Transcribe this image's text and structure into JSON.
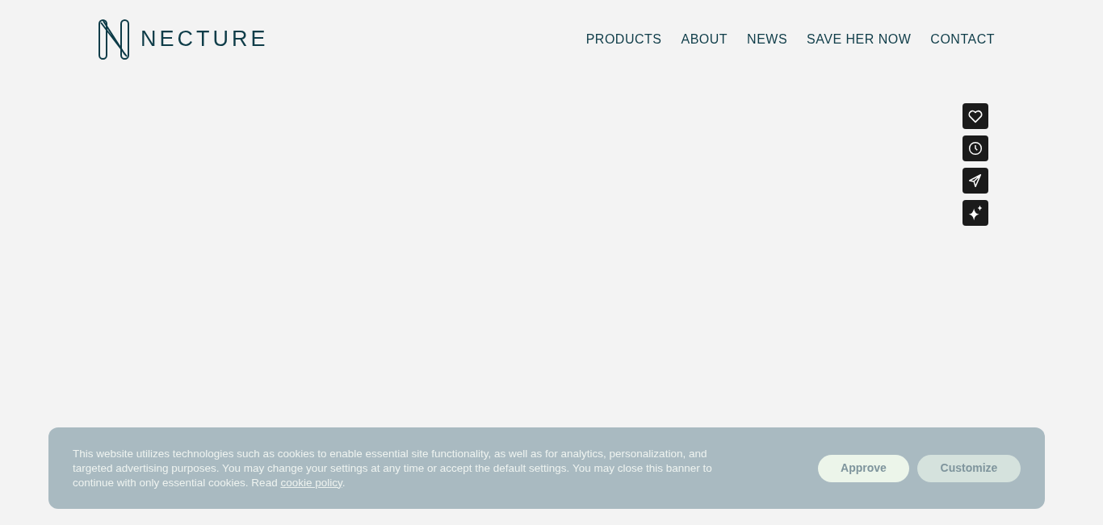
{
  "header": {
    "logo_text": "NECTURE",
    "nav": [
      "PRODUCTS",
      "ABOUT",
      "NEWS",
      "SAVE HER NOW",
      "CONTACT"
    ]
  },
  "side_buttons": [
    {
      "kind": "heart"
    },
    {
      "kind": "clock"
    },
    {
      "kind": "send"
    },
    {
      "kind": "sparkle"
    }
  ],
  "cookie_banner": {
    "text": "This website utilizes technologies such as cookies to enable essential site functionality, as well as for analytics, personalization, and targeted advertising purposes. You may change your settings at any time or accept the default settings. You may close this banner to continue with only essential cookies. Read ",
    "link": "cookie policy",
    "text_end": ".",
    "buttons": [
      {
        "label": "Approve",
        "kind": "primary"
      },
      {
        "label": "Customize",
        "kind": "secondary"
      }
    ]
  }
}
